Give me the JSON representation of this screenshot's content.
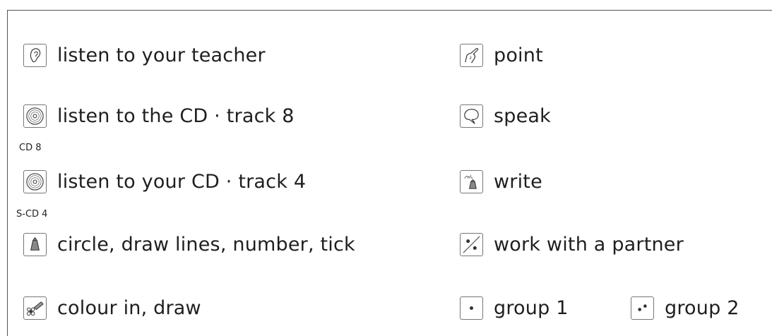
{
  "items": {
    "listen_teacher": {
      "label": "listen to your teacher",
      "icon": "ear-icon"
    },
    "listen_cd": {
      "label": "listen to the CD · track 8",
      "icon": "cd-icon",
      "sub": "CD 8"
    },
    "listen_your_cd": {
      "label": "listen to your CD · track 4",
      "icon": "cd-icon",
      "sub": "S-CD 4"
    },
    "circle_draw": {
      "label": "circle, draw lines, number, tick",
      "icon": "pencil-icon"
    },
    "colour_in": {
      "label": "colour in, draw",
      "icon": "crayon-flower-icon"
    },
    "point": {
      "label": "point",
      "icon": "pointing-hand-icon"
    },
    "speak": {
      "label": "speak",
      "icon": "speech-bubble-icon"
    },
    "write": {
      "label": "write",
      "icon": "writing-pencil-icon"
    },
    "partner": {
      "label": "work with a partner",
      "icon": "partner-dots-icon"
    },
    "group1": {
      "label": "group 1",
      "icon": "one-dot-icon"
    },
    "group2": {
      "label": "group 2",
      "icon": "two-dots-icon"
    }
  }
}
